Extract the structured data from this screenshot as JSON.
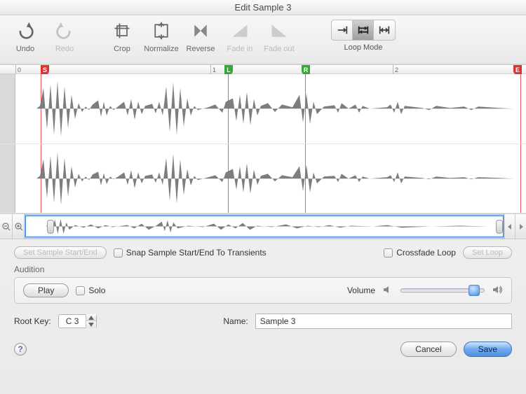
{
  "window": {
    "title": "Edit Sample 3"
  },
  "toolbar": {
    "undo": "Undo",
    "redo": "Redo",
    "crop": "Crop",
    "normalize": "Normalize",
    "reverse": "Reverse",
    "fade_in": "Fade in",
    "fade_out": "Fade out",
    "loop_mode": "Loop Mode"
  },
  "ruler": {
    "ticks": [
      "0",
      "1",
      "2"
    ],
    "markers": {
      "s": "S",
      "l": "L",
      "r": "R",
      "e": "E"
    }
  },
  "controls": {
    "set_sample": "Set Sample Start/End",
    "snap_transients": "Snap Sample Start/End To Transients",
    "crossfade_loop": "Crossfade Loop",
    "set_loop": "Set Loop"
  },
  "audition": {
    "legend": "Audition",
    "play": "Play",
    "solo": "Solo",
    "volume": "Volume"
  },
  "fields": {
    "root_key_label": "Root Key:",
    "root_key_value": "C 3",
    "name_label": "Name:",
    "name_value": "Sample 3"
  },
  "footer": {
    "cancel": "Cancel",
    "save": "Save"
  },
  "help": "?"
}
